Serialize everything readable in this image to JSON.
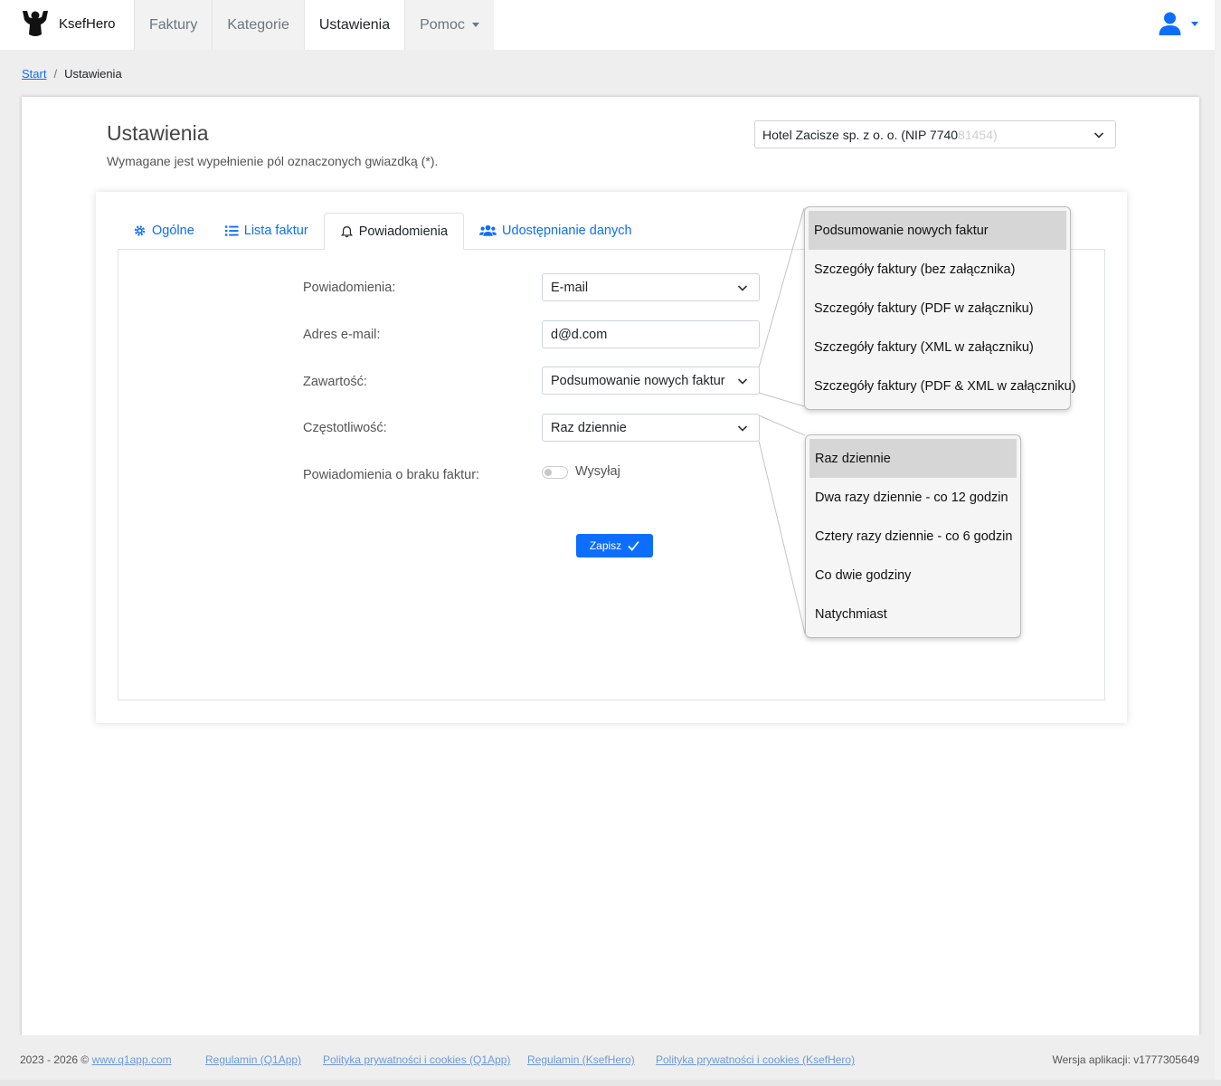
{
  "brand": {
    "name": "KsefHero",
    "logo_icon": "raised-arms-figure-icon"
  },
  "nav": {
    "items": [
      "Faktury",
      "Kategorie",
      "Ustawienia",
      "Pomoc"
    ],
    "active": "Ustawienia"
  },
  "user": {
    "icon": "user-icon",
    "color": "#0d6efd"
  },
  "breadcrumb": {
    "home": "Start",
    "current": "Ustawienia"
  },
  "page": {
    "title": "Ustawienia",
    "subtitle": "Wymagane jest wypełnienie pól oznaczonych gwiazdką (*)."
  },
  "company_select": {
    "visible_text": "Hotel Zacisze sp. z o. o. (NIP 7740",
    "blurred_text": "81454)"
  },
  "tabs": [
    {
      "label": "Ogólne",
      "icon": "gear-icon"
    },
    {
      "label": "Lista faktur",
      "icon": "list-icon"
    },
    {
      "label": "Powiadomienia",
      "icon": "bell-icon"
    },
    {
      "label": "Udostępnianie danych",
      "icon": "users-icon"
    }
  ],
  "active_tab": "Powiadomienia",
  "form": {
    "notifications_label": "Powiadomienia:",
    "notifications_value": "E-mail",
    "email_label": "Adres e-mail:",
    "email_value": "d@d.com",
    "content_label": "Zawartość:",
    "content_value": "Podsumowanie nowych faktur",
    "frequency_label": "Częstotliwość:",
    "frequency_value": "Raz dziennie",
    "no_invoices_label": "Powiadomienia o braku faktur:",
    "no_invoices_switch_label": "Wysyłaj",
    "no_invoices_enabled": false,
    "save_label": "Zapisz"
  },
  "content_options": [
    "Podsumowanie nowych faktur",
    "Szczegóły faktury (bez załącznika)",
    "Szczegóły faktury (PDF w załączniku)",
    "Szczegóły faktury (XML w załączniku)",
    "Szczegóły faktury (PDF & XML w załączniku)"
  ],
  "frequency_options": [
    "Raz dziennie",
    "Dwa razy dziennie - co 12 godzin",
    "Cztery razy dziennie - co 6 godzin",
    "Co dwie godziny",
    "Natychmiast"
  ],
  "footer": {
    "copyright_prefix": "2023 - 2026 ©",
    "site_link": "www.q1app.com",
    "links": [
      "Regulamin (Q1App)",
      "Polityka prywatności i cookies (Q1App)",
      "Regulamin (KsefHero)",
      "Polityka prywatności i cookies (KsefHero)"
    ],
    "version": "Wersja aplikacji: v1777305649"
  }
}
